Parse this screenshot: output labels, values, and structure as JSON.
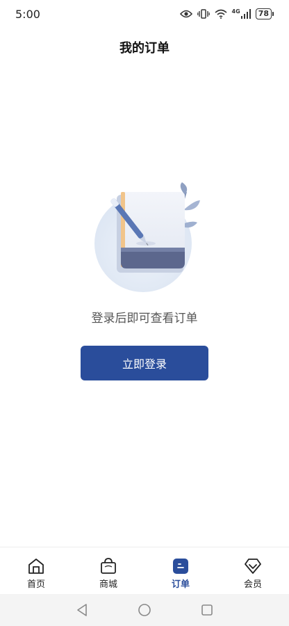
{
  "status_bar": {
    "time": "5:00",
    "network": "4G",
    "battery": "78",
    "icons": [
      "eye-icon",
      "vibrate-icon",
      "wifi-icon",
      "signal-icon",
      "battery-icon"
    ]
  },
  "header": {
    "title": "我的订单"
  },
  "empty_state": {
    "illustration": "notebook-pen-leaf-illustration",
    "message": "登录后即可查看订单",
    "login_button": "立即登录"
  },
  "bottom_nav": {
    "items": [
      {
        "label": "首页",
        "icon": "home-icon",
        "active": false
      },
      {
        "label": "商城",
        "icon": "shopping-bag-icon",
        "active": false
      },
      {
        "label": "订单",
        "icon": "order-icon",
        "active": true
      },
      {
        "label": "会员",
        "icon": "diamond-icon",
        "active": false
      }
    ]
  },
  "system_nav": {
    "buttons": [
      "back-icon",
      "home-circle-icon",
      "recents-icon"
    ]
  },
  "colors": {
    "accent": "#2a4d9b",
    "background": "#ffffff",
    "system_bar": "#f4f4f4"
  }
}
